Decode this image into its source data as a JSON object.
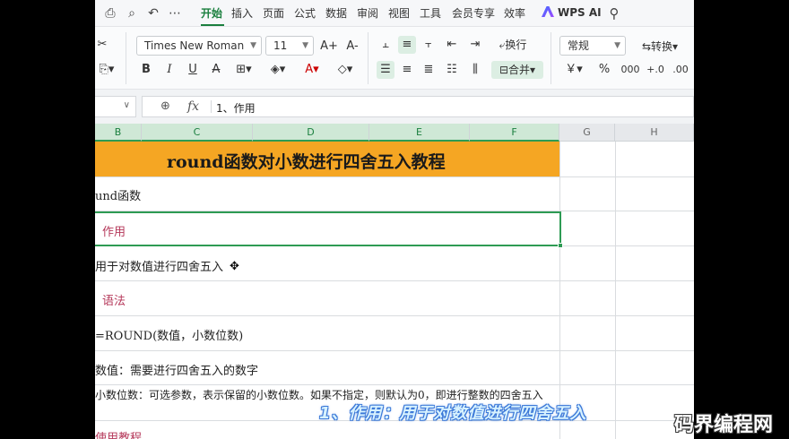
{
  "menubar": {
    "tabs": [
      "开始",
      "插入",
      "页面",
      "公式",
      "数据",
      "审阅",
      "视图",
      "工具",
      "会员专享",
      "效率"
    ],
    "active_tab": "开始",
    "wps_ai": "WPS AI",
    "quick_icons": [
      "print-icon",
      "print-preview-icon",
      "undo-icon",
      "more-icon",
      "search-icon"
    ]
  },
  "ribbon": {
    "font_name": "Times New Roman",
    "font_size": "11",
    "number_format": "常规",
    "wrap_label": "换行",
    "merge_label": "合并",
    "convert_label": "转换",
    "format_bold": "B",
    "format_italic": "I",
    "format_underline": "U",
    "format_strike": "A",
    "currency": "￥",
    "percent": "%",
    "thousands": "000",
    "dec_inc": "+.0",
    "dec_dec": ".00",
    "grow_font": "A+",
    "shrink_font": "A-"
  },
  "formula_bar": {
    "content": "1、作用"
  },
  "columns": [
    "B",
    "C",
    "D",
    "E",
    "F",
    "G",
    "H"
  ],
  "sheet": {
    "title": "round函数对小数进行四舍五入教程",
    "rows": [
      {
        "text": "und函数",
        "style": "normal"
      },
      {
        "text": "作用",
        "style": "red"
      },
      {
        "text": "用于对数值进行四舍五入",
        "style": "normal"
      },
      {
        "text": "语法",
        "style": "red"
      },
      {
        "text": "=ROUND(数值，小数位数)",
        "style": "normal"
      },
      {
        "text": "数值：需要进行四舍五入的数字",
        "style": "normal"
      },
      {
        "text": "小数位数：可选参数，表示保留的小数位数。如果不指定，则默认为0，即进行整数的四舍五入",
        "style": "normal"
      },
      {
        "text": "使用教程",
        "style": "red"
      }
    ]
  },
  "overlay": {
    "subtitle": "1、作用：用于对数值进行四舍五入",
    "watermark": "码界编程网"
  },
  "colors": {
    "accent": "#1a7f3e",
    "title_fill": "#f5a623",
    "heading_text": "#b5385a"
  }
}
